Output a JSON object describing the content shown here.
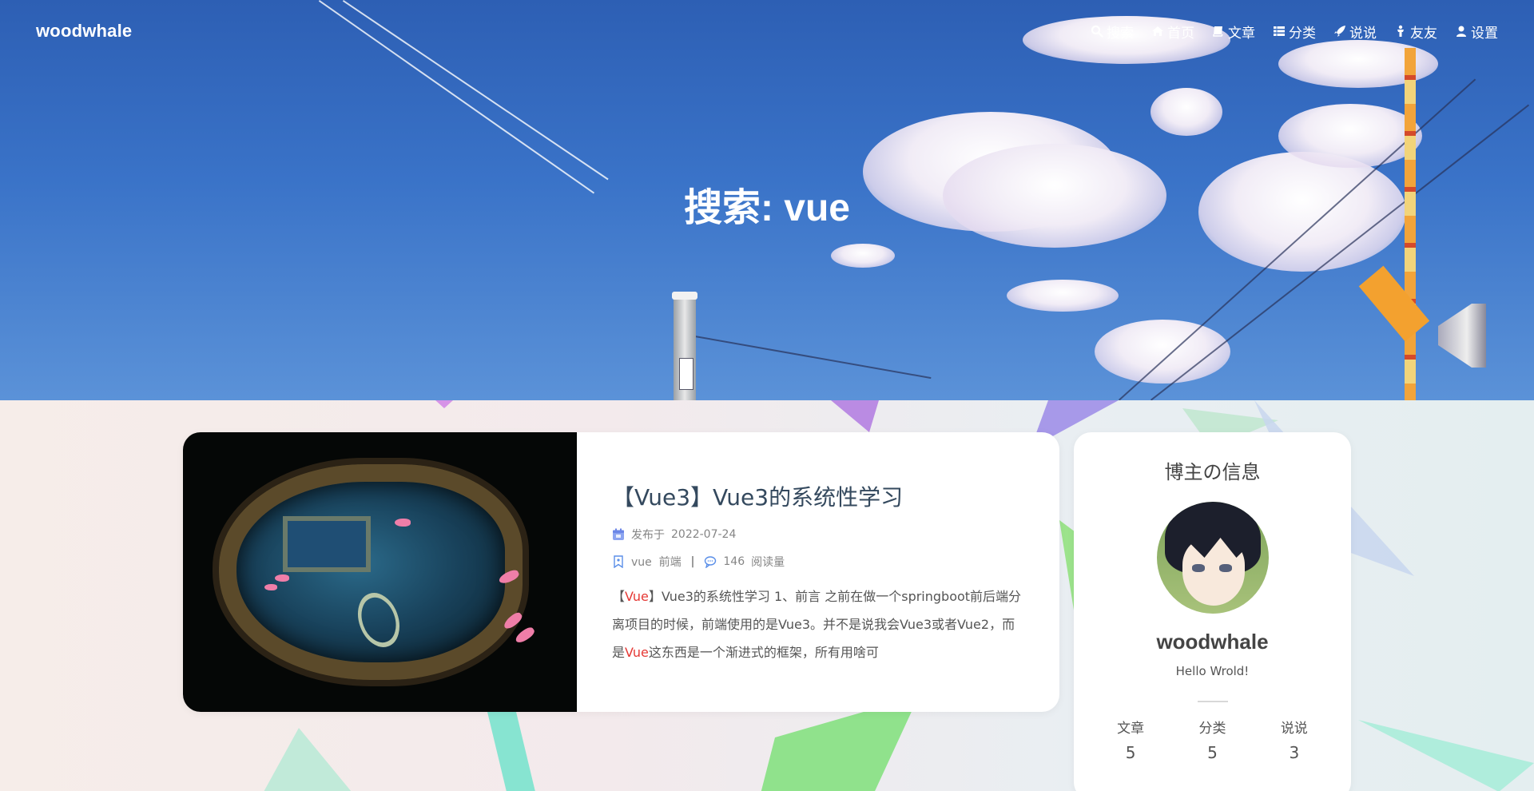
{
  "nav": {
    "brand": "woodwhale",
    "items": [
      {
        "label": "搜索",
        "icon": "search-icon"
      },
      {
        "label": "首页",
        "icon": "home-icon"
      },
      {
        "label": "文章",
        "icon": "book-icon"
      },
      {
        "label": "分类",
        "icon": "list-icon"
      },
      {
        "label": "说说",
        "icon": "rocket-icon"
      },
      {
        "label": "友友",
        "icon": "person-icon"
      },
      {
        "label": "设置",
        "icon": "user-icon"
      }
    ]
  },
  "hero": {
    "title": "搜索: vue"
  },
  "post": {
    "title": "【Vue3】Vue3的系统性学习",
    "published_label": "发布于",
    "published_date": "2022-07-24",
    "tags": "vue  前端",
    "separator": "|",
    "views": "146",
    "views_label": "阅读量",
    "excerpt": {
      "part1": "【",
      "hl1": "Vue",
      "part2": "】Vue3的系统性学习 1、前言 之前在做一个springboot前后端分离项目的时候，前端使用的是Vue3。并不是说我会Vue3或者Vue2，而是",
      "hl2": "Vue",
      "part3": "这东西是一个渐进式的框架，所有用啥可"
    }
  },
  "author": {
    "heading": "博主の信息",
    "name": "woodwhale",
    "bio": "Hello Wrold!",
    "stats": [
      {
        "label": "文章",
        "value": "5"
      },
      {
        "label": "分类",
        "value": "5"
      },
      {
        "label": "说说",
        "value": "3"
      }
    ]
  },
  "colors": {
    "highlight": "#e53935",
    "title_text": "#34495e"
  }
}
